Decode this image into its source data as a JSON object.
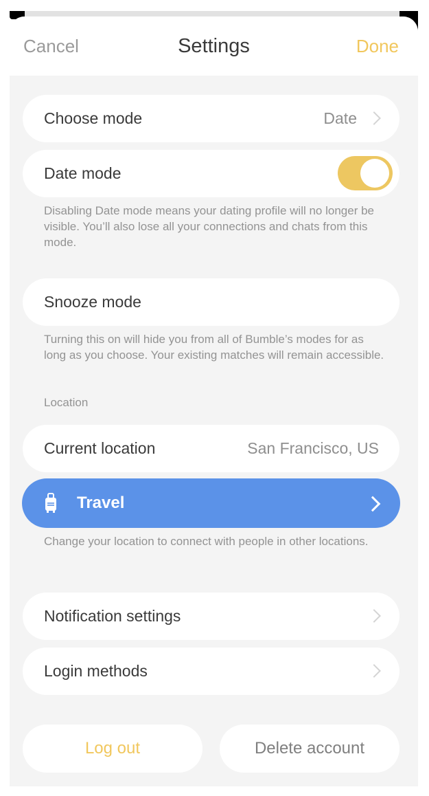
{
  "header": {
    "cancel_label": "Cancel",
    "title": "Settings",
    "done_label": "Done"
  },
  "rows": {
    "choose_mode": {
      "label": "Choose mode",
      "value": "Date"
    },
    "date_mode": {
      "label": "Date mode",
      "toggle_on": true
    },
    "date_mode_note": "Disabling Date mode means your dating profile will no longer be visible. You’ll also lose all your connections and chats from this mode.",
    "snooze_mode": {
      "label": "Snooze mode"
    },
    "snooze_mode_note": "Turning this on will hide you from all of Bumble’s modes for as long as you choose. Your existing matches will remain accessible.",
    "location_section_label": "Location",
    "current_location": {
      "label": "Current location",
      "value": "San Francisco, US"
    },
    "travel": {
      "label": "Travel",
      "icon": "suitcase-icon"
    },
    "travel_note": "Change your location to connect with people in other locations.",
    "notification_settings": {
      "label": "Notification settings"
    },
    "login_methods": {
      "label": "Login methods"
    }
  },
  "footer": {
    "logout_label": "Log out",
    "delete_label": "Delete account"
  },
  "colors": {
    "accent_yellow": "#f1c75d",
    "toggle_yellow": "#edc761",
    "travel_blue": "#5b92e8",
    "background_gray": "#f4f4f4"
  }
}
